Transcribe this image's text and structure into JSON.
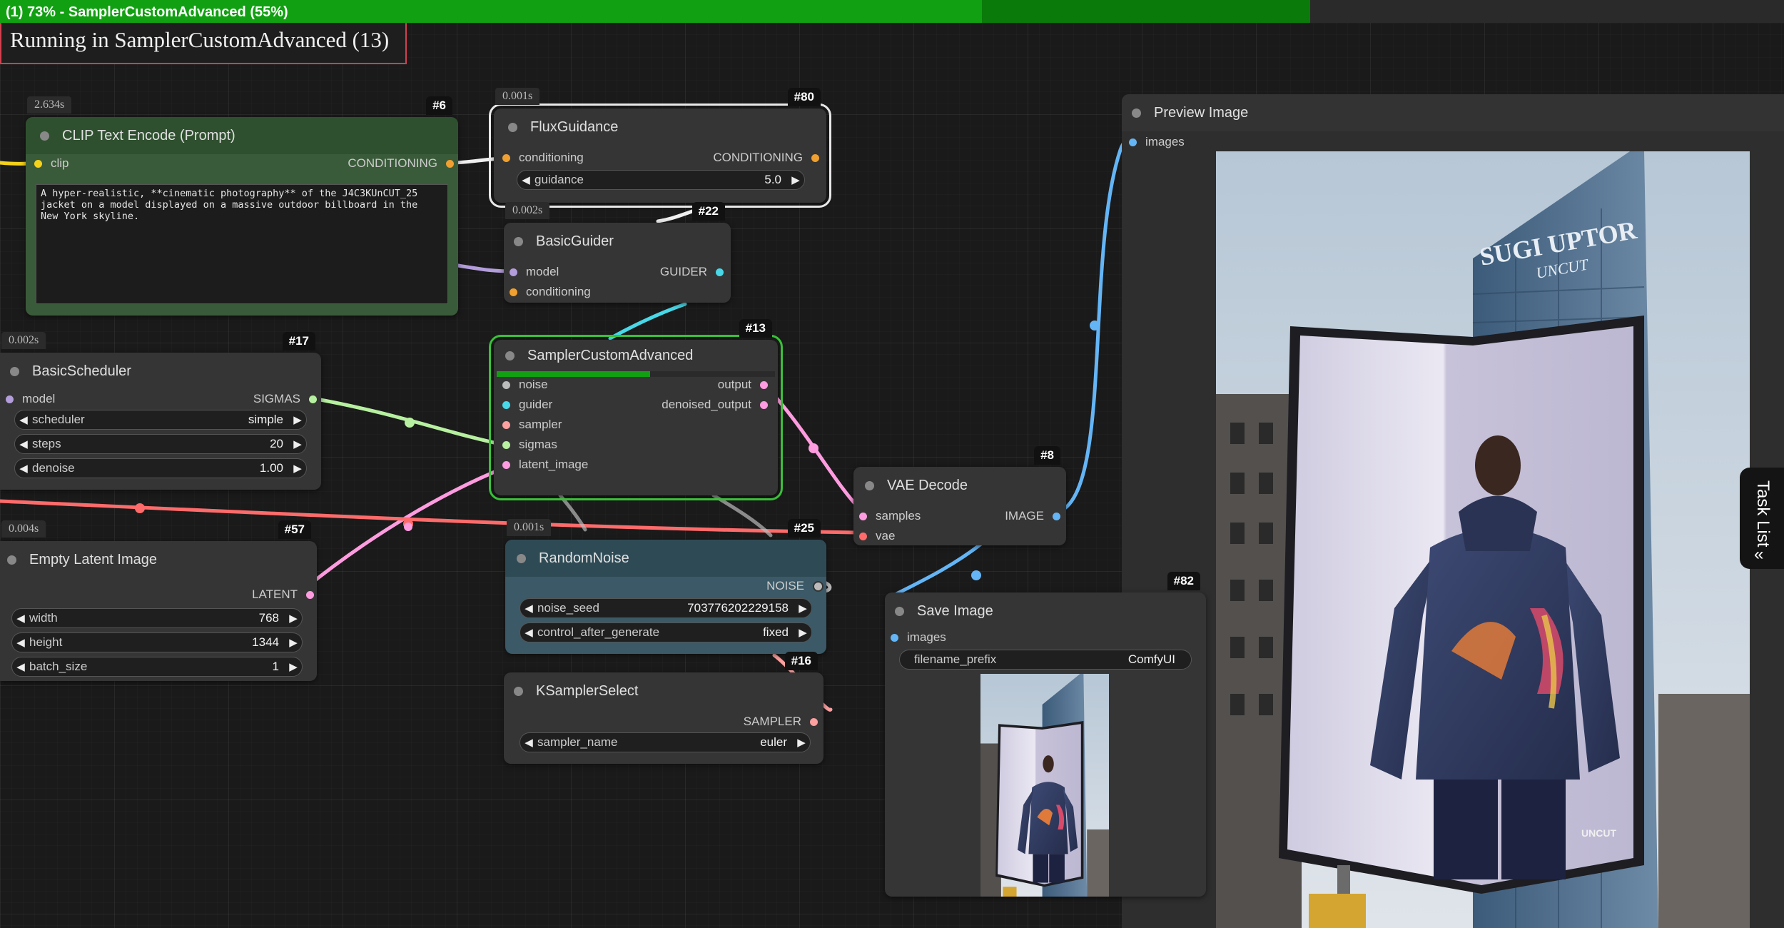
{
  "progress": {
    "text": "(1) 73% - SamplerCustomAdvanced (55%)",
    "overall_percent": 73,
    "node_percent": 55
  },
  "running_banner": "Running in SamplerCustomAdvanced (13)",
  "nodes": {
    "clip_text_encode": {
      "id": "#6",
      "time": "2.634s",
      "title": "CLIP Text Encode (Prompt)",
      "input": "clip",
      "output": "CONDITIONING",
      "prompt": "A hyper-realistic, **cinematic photography** of the J4C3KUnCUT_25\njacket on a model displayed on a massive outdoor billboard in the\nNew York skyline."
    },
    "flux_guidance": {
      "id": "#80",
      "time": "0.001s",
      "title": "FluxGuidance",
      "input": "conditioning",
      "output": "CONDITIONING",
      "widget": {
        "label": "guidance",
        "value": "5.0"
      }
    },
    "basic_guider": {
      "id": "#22",
      "time": "0.002s",
      "title": "BasicGuider",
      "inputs": [
        "model",
        "conditioning"
      ],
      "output": "GUIDER"
    },
    "sampler_custom_advanced": {
      "id": "#13",
      "title": "SamplerCustomAdvanced",
      "progress": 0.55,
      "inputs": [
        "noise",
        "guider",
        "sampler",
        "sigmas",
        "latent_image"
      ],
      "outputs": [
        "output",
        "denoised_output"
      ]
    },
    "basic_scheduler": {
      "id": "#17",
      "time": "0.002s",
      "title": "BasicScheduler",
      "input": "model",
      "output": "SIGMAS",
      "widgets": [
        {
          "label": "scheduler",
          "value": "simple"
        },
        {
          "label": "steps",
          "value": "20"
        },
        {
          "label": "denoise",
          "value": "1.00"
        }
      ]
    },
    "empty_latent": {
      "id": "#57",
      "time": "0.004s",
      "title": "Empty Latent Image",
      "output": "LATENT",
      "widgets": [
        {
          "label": "width",
          "value": "768"
        },
        {
          "label": "height",
          "value": "1344"
        },
        {
          "label": "batch_size",
          "value": "1"
        }
      ]
    },
    "random_noise": {
      "id": "#25",
      "time": "0.001s",
      "title": "RandomNoise",
      "output": "NOISE",
      "widgets": [
        {
          "label": "noise_seed",
          "value": "703776202229158"
        },
        {
          "label": "control_after_generate",
          "value": "fixed"
        }
      ]
    },
    "ksampler_select": {
      "id": "#16",
      "title": "KSamplerSelect",
      "output": "SAMPLER",
      "widget": {
        "label": "sampler_name",
        "value": "euler"
      }
    },
    "vae_decode": {
      "id": "#8",
      "title": "VAE Decode",
      "inputs": [
        "samples",
        "vae"
      ],
      "output": "IMAGE"
    },
    "save_image": {
      "id": "#82",
      "title": "Save Image",
      "input": "images",
      "widget": {
        "label": "filename_prefix",
        "value": "ComfyUI"
      }
    },
    "preview_image": {
      "title": "Preview Image",
      "input": "images"
    }
  },
  "billboard_text": {
    "tower_sign": "SUGI UPTOR",
    "tower_sub": "UNCUT",
    "corner": "UNCUT"
  },
  "task_list": {
    "label": "Task List",
    "icon": "double-chevron-left-icon"
  },
  "colors": {
    "clip": "#f5d21a",
    "conditioning": "#f0a030",
    "model": "#b39ddb",
    "guider": "#48d8e8",
    "sigmas": "#b6f0a0",
    "latent": "#ff9ce0",
    "noise": "#bbbbbb",
    "sampler": "#ffa0a0",
    "vae": "#ff6b6b",
    "image": "#64b5f6"
  }
}
